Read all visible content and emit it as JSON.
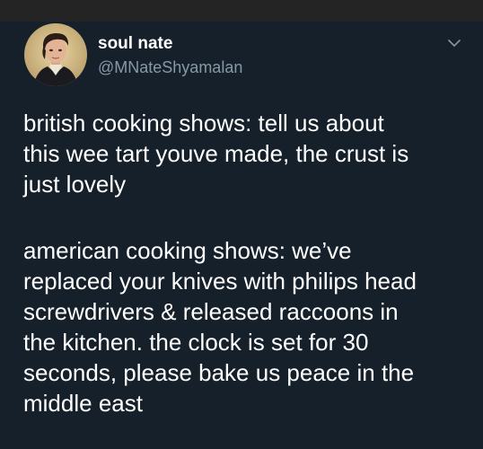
{
  "colors": {
    "background": "#15202b",
    "top_strip": "#242424",
    "text_primary": "#ffffff",
    "text_secondary": "#8899a6"
  },
  "tweet": {
    "display_name": "soul nate",
    "handle": "@MNateShyamalan",
    "menu_icon": "chevron-down-icon",
    "paragraphs": [
      "british cooking shows: tell us about\nthis wee tart youve made, the crust is\njust lovely",
      "american cooking shows: we’ve\nreplaced your knives with philips head\nscrewdrivers & released raccoons in\nthe kitchen. the clock is set for 30\nseconds, please bake us peace in the\nmiddle east"
    ]
  }
}
